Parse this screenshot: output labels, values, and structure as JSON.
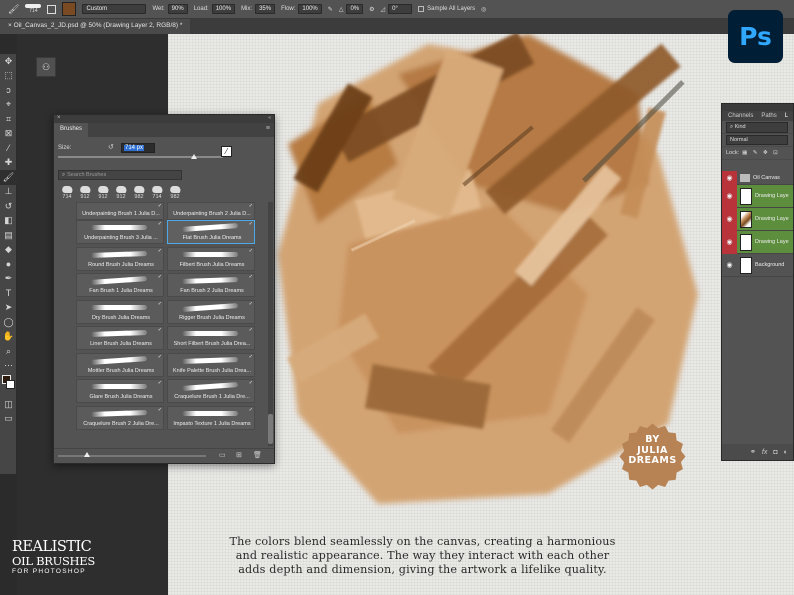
{
  "options_bar": {
    "brush_size": "714",
    "preset": "Custom",
    "wet_label": "Wet:",
    "wet_value": "90%",
    "load_label": "Load:",
    "load_value": "100%",
    "mix_label": "Mix:",
    "mix_value": "35%",
    "flow_label": "Flow:",
    "flow_value": "100%",
    "angle_value": "0%",
    "smoothing_value": "0°",
    "sample_all_layers": "Sample All Layers"
  },
  "document_tab": {
    "title": "Oil_Canvas_2_JD.psd @ 50% (Drawing Layer 2, RGB/8) *"
  },
  "app_logo": {
    "text": "Ps",
    "color": "#31a8ff"
  },
  "brushes_panel": {
    "tab": "Brushes",
    "size_label": "Size:",
    "size_value": "714 px",
    "search_placeholder": "Search Brushes",
    "presets": [
      "714",
      "912",
      "912",
      "912",
      "982",
      "714",
      "982"
    ],
    "brushes": [
      {
        "name": "Underpainting Brush 1 Julia D..."
      },
      {
        "name": "Underpainting Brush 2 Julia D..."
      },
      {
        "name": "Underpainting Brush 3 Julia ..."
      },
      {
        "name": "Flat Brush Julia Dreams",
        "selected": true
      },
      {
        "name": "Round Brush Julia Dreams"
      },
      {
        "name": "Filbert Brush Julia Dreams"
      },
      {
        "name": "Fan Brush 1 Julia Dreams"
      },
      {
        "name": "Fan Brush 2 Julia Dreams"
      },
      {
        "name": "Dry Brush Julia Dreams"
      },
      {
        "name": "Rigger Brush Julia Dreams"
      },
      {
        "name": "Liner Brush Julia Dreams"
      },
      {
        "name": "Short Filbert Brush Julia Drea..."
      },
      {
        "name": "Mottler Brush Julia Dreams"
      },
      {
        "name": "Knife Palette Brush Julia Drea..."
      },
      {
        "name": "Glare Brush Julia Dreams"
      },
      {
        "name": "Craquelure Brush 1 Julia Dre..."
      },
      {
        "name": "Craquelure Brush 2 Julia Dre..."
      },
      {
        "name": "Impasto Texture 1 Julia Dreams"
      }
    ]
  },
  "layers_panel": {
    "tabs": [
      "Channels",
      "Paths",
      "L"
    ],
    "kind": "Kind",
    "blend_mode": "Normal",
    "lock_label": "Lock:",
    "layers": [
      {
        "name": "Oil Canvas",
        "type": "group",
        "visible": true
      },
      {
        "name": "Drawing Laye",
        "visible": true
      },
      {
        "name": "Drawing Laye",
        "visible": true
      },
      {
        "name": "Drawing Laye",
        "visible": true
      },
      {
        "name": "Background",
        "visible": true
      }
    ],
    "bottom_icons": [
      "link-icon",
      "fx-icon",
      "mask-icon",
      "adjust-icon"
    ]
  },
  "branding": {
    "line1": "REALISTIC",
    "line2": "OIL BRUSHES",
    "line3": "FOR PHOTOSHOP"
  },
  "badge": {
    "line1": "BY",
    "line2": "JULIA",
    "line3": "DREAMS",
    "color": "#b78355"
  },
  "caption": {
    "line1": "The colors blend seamlessly on the canvas, creating a harmonious",
    "line2": "and realistic appearance. The way they interact with each other",
    "line3": "adds depth and dimension, giving the artwork a lifelike quality."
  },
  "colors": {
    "ui_dark": "#2b2b2b",
    "panel": "#535353",
    "canvas": "#e9e9e6",
    "paint_light": "#d1a271",
    "paint_dark": "#7a4a22",
    "layer_highlight": "#5c8e3e"
  }
}
